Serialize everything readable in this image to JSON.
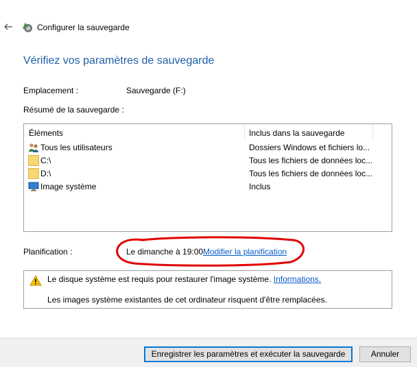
{
  "window": {
    "title": "Configurer la sauvegarde"
  },
  "page": {
    "heading": "Vérifiez vos paramètres de sauvegarde",
    "location_label": "Emplacement :",
    "location_value": "Sauvegarde (F:)",
    "summary_label": "Résumé de la sauvegarde :"
  },
  "table": {
    "columns": [
      "Éléments",
      "Inclus dans la sauvegarde"
    ],
    "rows": [
      {
        "icon": "users-icon",
        "name": "Tous les utilisateurs",
        "included": "Dossiers Windows et fichiers lo..."
      },
      {
        "icon": "folder-icon",
        "name": "C:\\",
        "included": "Tous les fichiers de données loc..."
      },
      {
        "icon": "folder-icon",
        "name": "D:\\",
        "included": "Tous les fichiers de données loc..."
      },
      {
        "icon": "monitor-icon",
        "name": "Image système",
        "included": "Inclus"
      }
    ]
  },
  "schedule": {
    "label": "Planification :",
    "value": "Le dimanche à 19:00",
    "link": "Modifier la planification"
  },
  "warning": {
    "line1": "Le disque système est requis pour restaurer l'image système.",
    "link": "Informations.",
    "line2": "Les images système existantes de cet ordinateur risquent d'être remplacées."
  },
  "buttons": {
    "save_run": "Enregistrer les paramètres et exécuter la sauvegarde",
    "cancel": "Annuler"
  },
  "colors": {
    "heading": "#1e5fa8",
    "link": "#0a5ac8",
    "annotation": "#e00000",
    "primary_border": "#0078d7"
  }
}
